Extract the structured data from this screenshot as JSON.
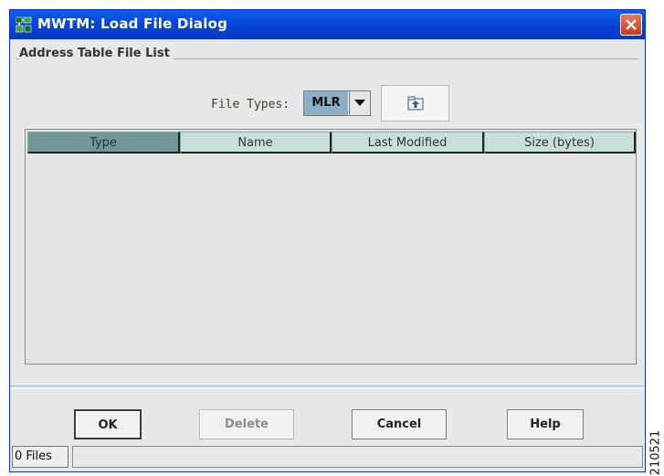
{
  "window": {
    "title": "MWTM: Load File Dialog"
  },
  "group": {
    "title": "Address Table File List"
  },
  "file_types": {
    "label": "File Types:",
    "selected": "MLR"
  },
  "table": {
    "columns": [
      "Type",
      "Name",
      "Last Modified",
      "Size (bytes)"
    ],
    "rows": []
  },
  "buttons": {
    "ok": "OK",
    "delete": "Delete",
    "cancel": "Cancel",
    "help": "Help"
  },
  "status": {
    "count": "0 Files"
  },
  "figure_id": "210521",
  "colors": {
    "titlebar": "#0848d8",
    "header": "#c7dedd",
    "header_sorted": "#6f9897",
    "combo_selected": "#8cafc7"
  }
}
